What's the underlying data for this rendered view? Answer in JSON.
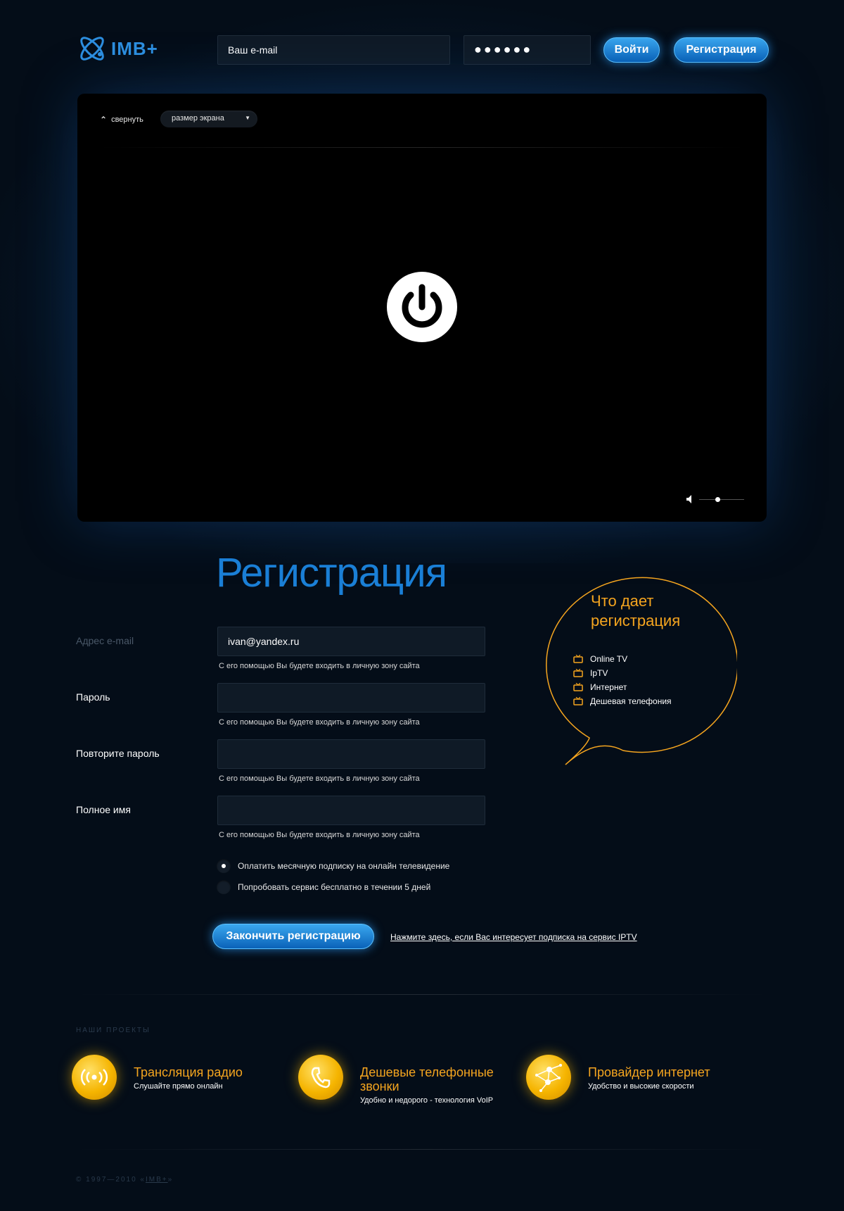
{
  "header": {
    "logo_text": "IMB+",
    "email_placeholder": "Ваш e-mail",
    "password_mask": "●●●●●●",
    "login_label": "Войти",
    "register_label": "Регистрация"
  },
  "player": {
    "collapse_label": "свернуть",
    "screen_size_label": "размер экрана",
    "volume_level": 0.4
  },
  "registration": {
    "title": "Регистрация",
    "fields": [
      {
        "label": "Адрес e-mail",
        "value": "ivan@yandex.ru",
        "hint": "С его помощью Вы будете входить в личную зону сайта"
      },
      {
        "label": "Пароль",
        "value": "",
        "hint": "С его помощью Вы будете входить в личную зону сайта"
      },
      {
        "label": "Повторите пароль",
        "value": "",
        "hint": "С его помощью Вы будете входить в личную зону сайта"
      },
      {
        "label": "Полное имя",
        "value": "",
        "hint": "С его помощью Вы будете входить в личную зону сайта"
      }
    ],
    "options": [
      {
        "label": "Оплатить месячную подписку на онлайн телевидение",
        "selected": true
      },
      {
        "label": "Попробовать сервис бесплатно в течении 5 дней",
        "selected": false
      }
    ],
    "finish_label": "Закончить регистрацию",
    "iptv_link": "Нажмите здесь, если Вас интересует подписка на сервис IPTV"
  },
  "benefits": {
    "title": "Что дает регистрация",
    "items": [
      "Online TV",
      "IpTV",
      "Интернет",
      "Дешевая телефония"
    ]
  },
  "projects": {
    "title": "НАШИ ПРОЕКТЫ",
    "items": [
      {
        "icon": "radio-icon",
        "title": "Трансляция радио",
        "subtitle": "Слушайте прямо онлайн"
      },
      {
        "icon": "phone-icon",
        "title": "Дешевые телефонные звонки",
        "subtitle": "Удобно и недорого - технология VoIP"
      },
      {
        "icon": "network-icon",
        "title": "Провайдер интернет",
        "subtitle": "Удобство и высокие скорости"
      }
    ]
  },
  "footer": {
    "copyright": "© 1997—2010 «",
    "brand": "IMB+",
    "copyright_end": "»"
  },
  "colors": {
    "accent_blue": "#1a7fd6",
    "accent_orange": "#f5a51f",
    "background": "#040d18"
  }
}
